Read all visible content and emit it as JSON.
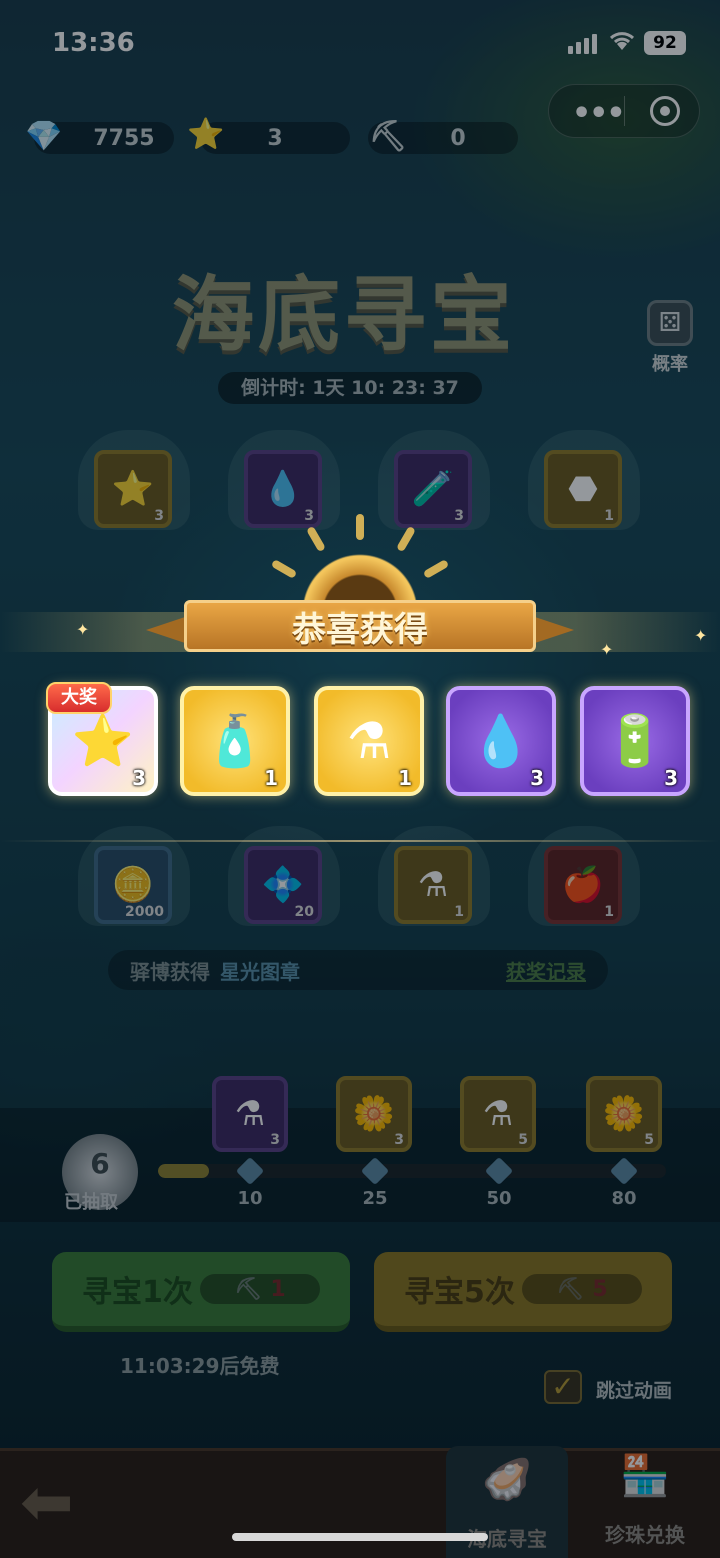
{
  "status": {
    "time": "13:36",
    "battery": "92"
  },
  "currency": [
    {
      "icon": "diamond-icon",
      "glyph": "💎",
      "value": "7755"
    },
    {
      "icon": "star-badge-icon",
      "glyph": "⭐",
      "value": "3"
    },
    {
      "icon": "shovel-icon",
      "glyph": "⛏",
      "value": "0"
    }
  ],
  "title": "海底寻宝",
  "countdown": "倒计时: 1天 10: 23: 37",
  "probability": {
    "label": "概率",
    "glyph": "⚄"
  },
  "grid_rows": [
    [
      {
        "type": "gold",
        "glyph": "⭐",
        "count": "3"
      },
      {
        "type": "purp",
        "glyph": "💧",
        "count": "3"
      },
      {
        "type": "purp",
        "glyph": "🧪",
        "count": "3"
      },
      {
        "type": "gold",
        "glyph": "⬣",
        "count": "1"
      }
    ],
    [
      {
        "type": "blue",
        "glyph": "🪙",
        "count": "2000"
      },
      {
        "type": "purp",
        "glyph": "💠",
        "count": "20"
      },
      {
        "type": "gold",
        "glyph": "⚗",
        "count": "1"
      },
      {
        "type": "red",
        "glyph": "🍎",
        "count": "1"
      }
    ]
  ],
  "announce": {
    "prefix": "驿博获得",
    "item": "星光图章",
    "record": "获奖记录"
  },
  "progress": {
    "drawn_count": "6",
    "drawn_label": "已抽取",
    "fill_fraction": 0.1,
    "milestones": [
      {
        "label": "10",
        "glyph": "⚗",
        "count": "3",
        "type": "purp"
      },
      {
        "label": "25",
        "glyph": "🌼",
        "count": "3",
        "type": "gold"
      },
      {
        "label": "50",
        "glyph": "⚗",
        "count": "5",
        "type": "gold"
      },
      {
        "label": "80",
        "glyph": "🌼",
        "count": "5",
        "type": "gold"
      }
    ]
  },
  "buttons": {
    "once": {
      "label": "寻宝1次",
      "cost": "1"
    },
    "five": {
      "label": "寻宝5次",
      "cost": "5"
    }
  },
  "free_text": "11:03:29后免费",
  "skip_label": "跳过动画",
  "nav": {
    "tab1": "海底寻宝",
    "tab2": "珍珠兑换"
  },
  "reward_popup": {
    "title": "恭喜获得",
    "grand_label": "大奖",
    "items": [
      {
        "type": "rain",
        "glyph": "⭐",
        "count": "3",
        "grand": true
      },
      {
        "type": "gold",
        "glyph": "🧴",
        "count": "1"
      },
      {
        "type": "gold",
        "glyph": "⚗",
        "count": "1"
      },
      {
        "type": "purp",
        "glyph": "💧",
        "count": "3"
      },
      {
        "type": "purp",
        "glyph": "🔋",
        "count": "3"
      }
    ]
  }
}
